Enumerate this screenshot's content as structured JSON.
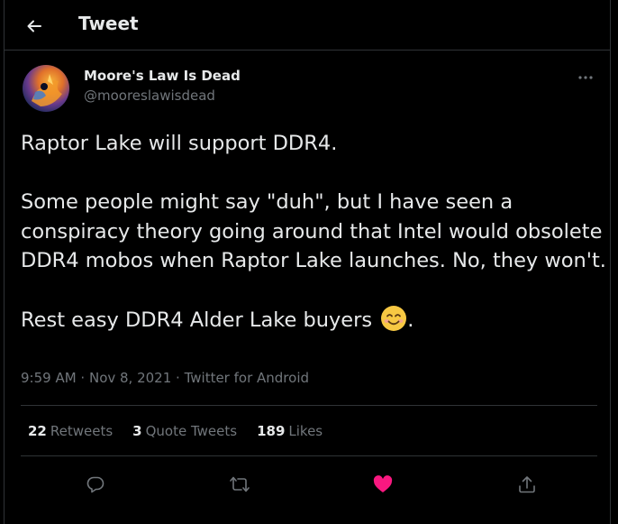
{
  "header": {
    "title": "Tweet",
    "back_icon": "back-arrow-icon"
  },
  "author": {
    "display_name": "Moore's Law Is Dead",
    "handle": "@mooreslawisdead"
  },
  "tweet": {
    "line1": "Raptor Lake will support DDR4.",
    "line2": "Some people might say \"duh\", but I have seen a conspiracy theory going around that Intel would obsolete DDR4 mobos when Raptor Lake launches. No, they won't.",
    "line3": "Rest easy DDR4 Alder Lake buyers",
    "line3_end": ".",
    "emoji": "smiling-face-icon"
  },
  "meta": {
    "time": "9:59 AM",
    "sep1": " · ",
    "date": "Nov 8, 2021",
    "sep2": " · ",
    "source": "Twitter for Android"
  },
  "stats": {
    "retweets_count": "22",
    "retweets_label": "Retweets",
    "quotes_count": "3",
    "quotes_label": "Quote Tweets",
    "likes_count": "189",
    "likes_label": "Likes"
  },
  "colors": {
    "background": "#000000",
    "text": "#e7e9ea",
    "muted": "#71767b",
    "like": "#f91880",
    "divider": "#2f3336"
  }
}
